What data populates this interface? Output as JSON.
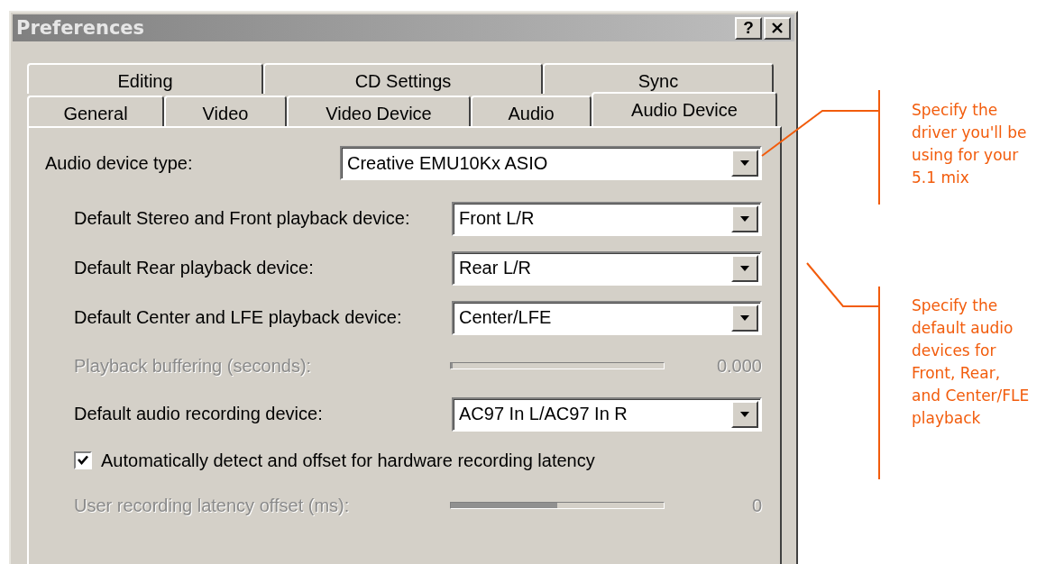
{
  "window": {
    "title": "Preferences",
    "help_button": "?"
  },
  "tabs": [
    [
      {
        "label": "Editing",
        "selected": false
      },
      {
        "label": "CD Settings",
        "selected": false
      },
      {
        "label": "Sync",
        "selected": false
      }
    ],
    [
      {
        "label": "General",
        "selected": false
      },
      {
        "label": "Video",
        "selected": false
      },
      {
        "label": "Video Device",
        "selected": false
      },
      {
        "label": "Audio",
        "selected": false
      },
      {
        "label": "Audio Device",
        "selected": true
      }
    ]
  ],
  "device_type": {
    "label": "Audio device type:",
    "value": "Creative EMU10Kx ASIO"
  },
  "rows": [
    {
      "kind": "dropdown",
      "label": "Default Stereo and Front playback device:",
      "value": "Front L/R",
      "disabled": false
    },
    {
      "kind": "dropdown",
      "label": "Default Rear playback device:",
      "value": "Rear L/R",
      "disabled": false
    },
    {
      "kind": "dropdown",
      "label": "Default Center and LFE playback device:",
      "value": "Center/LFE",
      "disabled": false
    },
    {
      "kind": "slider",
      "label": "Playback buffering (seconds):",
      "level": 0,
      "reading": "0.000",
      "disabled": true
    },
    {
      "kind": "dropdown",
      "label": "Default audio recording device:",
      "value": "AC97 In L/AC97 In R",
      "disabled": false
    },
    {
      "kind": "checkbox",
      "label": "Automatically detect and offset for hardware recording latency",
      "checked": true,
      "disabled": false
    },
    {
      "kind": "slider",
      "label": "User recording latency offset (ms):",
      "level": 0.5,
      "reading": "0",
      "disabled": true
    }
  ],
  "annotations": [
    "Specify the\ndriver you'll be\nusing for your\n5.1 mix",
    "Specify the\ndefault audio\ndevices for\nFront, Rear,\nand Center/FLE\nplayback"
  ]
}
